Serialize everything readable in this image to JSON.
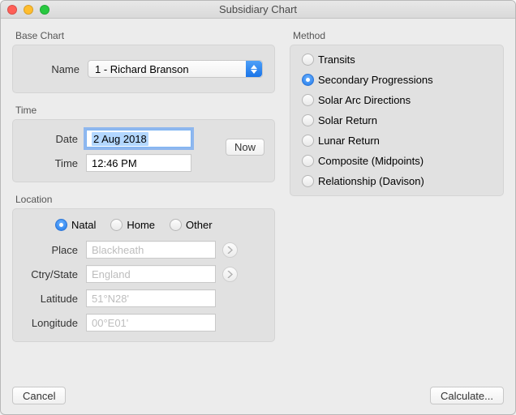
{
  "window": {
    "title": "Subsidiary Chart"
  },
  "baseChart": {
    "legend": "Base Chart",
    "nameLabel": "Name",
    "nameValue": "1 - Richard Branson"
  },
  "time": {
    "legend": "Time",
    "dateLabel": "Date",
    "dateValue": "2 Aug 2018",
    "timeLabel": "Time",
    "timeValue": "12:46 PM",
    "nowLabel": "Now"
  },
  "location": {
    "legend": "Location",
    "options": {
      "natal": "Natal",
      "home": "Home",
      "other": "Other"
    },
    "selected": "natal",
    "placeLabel": "Place",
    "placeValue": "Blackheath",
    "ctryLabel": "Ctry/State",
    "ctryValue": "England",
    "latLabel": "Latitude",
    "latValue": "51°N28'",
    "lonLabel": "Longitude",
    "lonValue": "00°E01'"
  },
  "method": {
    "legend": "Method",
    "options": [
      "Transits",
      "Secondary Progressions",
      "Solar Arc Directions",
      "Solar Return",
      "Lunar Return",
      "Composite (Midpoints)",
      "Relationship (Davison)"
    ],
    "selectedIndex": 1
  },
  "footer": {
    "cancel": "Cancel",
    "calculate": "Calculate..."
  }
}
